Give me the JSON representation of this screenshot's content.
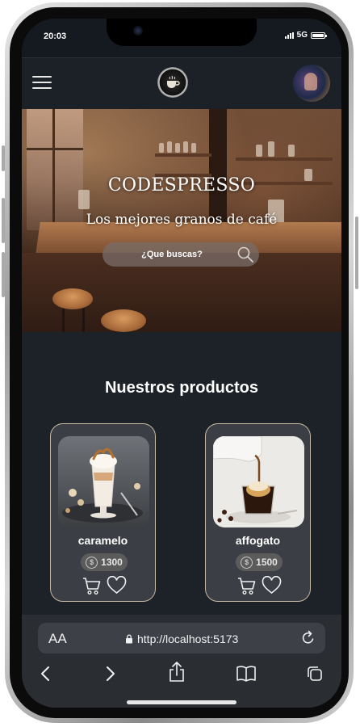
{
  "status_bar": {
    "time": "20:03",
    "network": "5G"
  },
  "app_bar": {
    "menu_icon": "hamburger-icon",
    "logo_icon": "coffee-logo-icon",
    "avatar_icon": "user-avatar"
  },
  "hero": {
    "title": "CODESPRESSO",
    "subtitle": "Los mejores granos de café",
    "search": {
      "placeholder": "¿Que buscas?",
      "icon": "search-icon"
    }
  },
  "products": {
    "title": "Nuestros productos",
    "items": [
      {
        "name": "caramelo",
        "price": "1300"
      },
      {
        "name": "affogato",
        "price": "1500"
      }
    ]
  },
  "browser": {
    "text_size_label": "AA",
    "url": "http://localhost:5173",
    "nav": [
      "back-icon",
      "forward-icon",
      "share-icon",
      "bookmarks-icon",
      "tabs-icon"
    ]
  },
  "colors": {
    "background": "#1d2128",
    "card_border": "#c6b89c",
    "card_bg": "#3b3e44",
    "text": "#ffffff"
  }
}
